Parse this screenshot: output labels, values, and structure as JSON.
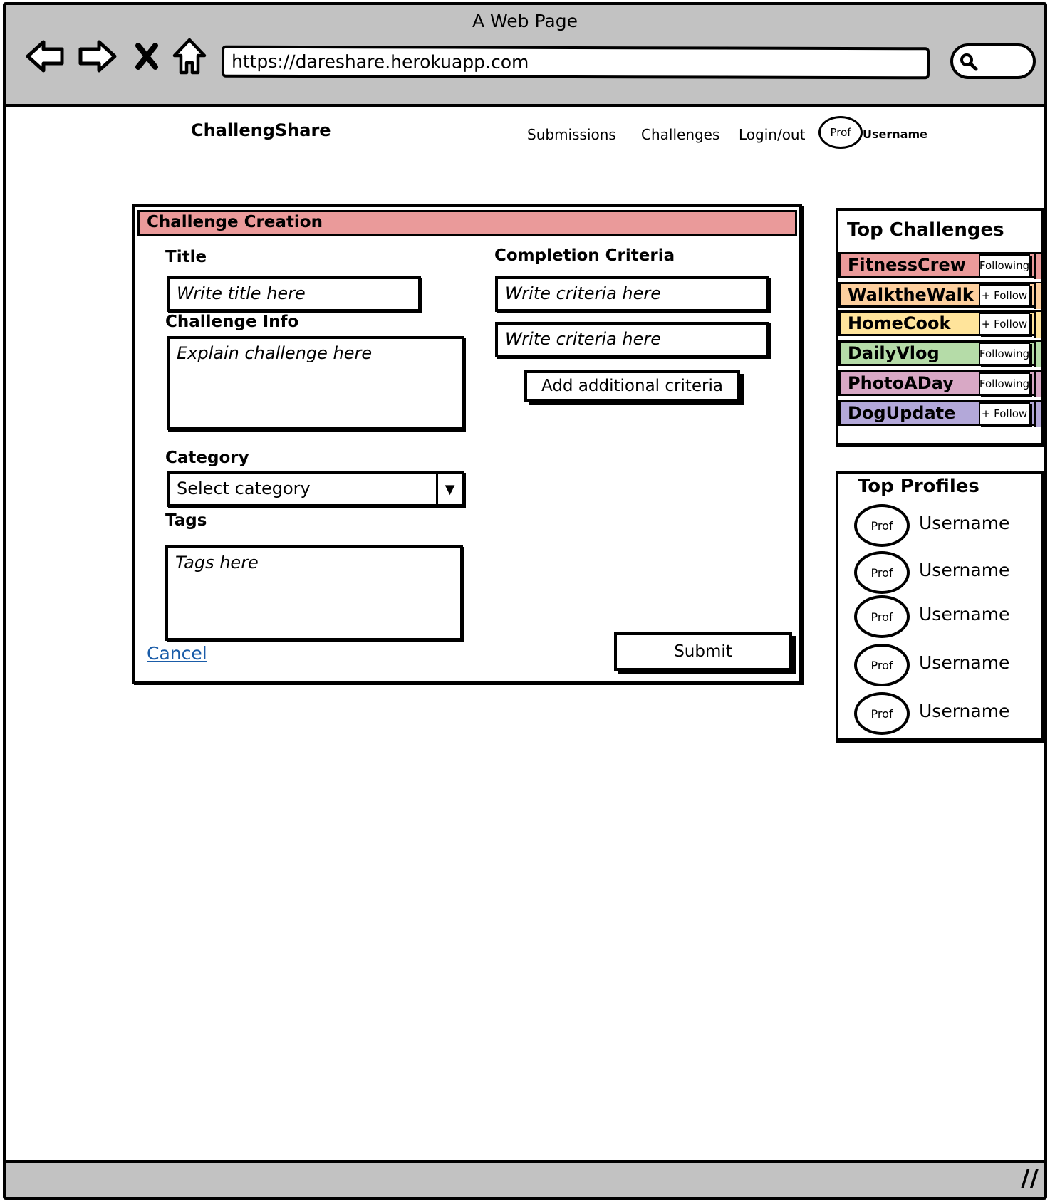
{
  "window": {
    "title": "A Web Page"
  },
  "browser": {
    "url": "https://dareshare.herokuapp.com",
    "icons": [
      "back-arrow-icon",
      "forward-arrow-icon",
      "close-icon",
      "home-icon",
      "search-icon",
      "resize-grip-icon"
    ]
  },
  "header": {
    "brand": "ChallengShare",
    "nav": [
      "Submissions",
      "Challenges",
      "Login/out"
    ],
    "avatar_text": "Prof",
    "username": "Username"
  },
  "form": {
    "title": "Challenge Creation",
    "header_color": "#ea9a9a",
    "title_label": "Title",
    "title_placeholder": "Write title here",
    "info_label": "Challenge Info",
    "info_placeholder": "Explain challenge here",
    "category_label": "Category",
    "category_value": "Select category",
    "tags_label": "Tags",
    "tags_placeholder": "Tags here",
    "criteria_label": "Completion Criteria",
    "criteria": [
      "Write criteria here",
      "Write criteria here"
    ],
    "add_criteria_button": "Add additional criteria",
    "cancel": "Cancel",
    "submit": "Submit"
  },
  "top_challenges": {
    "title": "Top Challenges",
    "items": [
      {
        "name": "FitnessCrew",
        "action": "Following",
        "color": "#ea9a9a"
      },
      {
        "name": "WalktheWalk",
        "action": "+ Follow",
        "color": "#fdcf9e"
      },
      {
        "name": "HomeCook",
        "action": "+ Follow",
        "color": "#ffe49b"
      },
      {
        "name": "DailyVlog",
        "action": "Following",
        "color": "#b5dca8"
      },
      {
        "name": "PhotoADay",
        "action": "Following",
        "color": "#d8a8c5"
      },
      {
        "name": "DogUpdate",
        "action": "+ Follow",
        "color": "#b3a8d9"
      }
    ]
  },
  "top_profiles": {
    "title": "Top Profiles",
    "items": [
      {
        "avatar": "Prof",
        "name": "Username"
      },
      {
        "avatar": "Prof",
        "name": "Username"
      },
      {
        "avatar": "Prof",
        "name": "Username"
      },
      {
        "avatar": "Prof",
        "name": "Username"
      },
      {
        "avatar": "Prof",
        "name": "Username"
      }
    ]
  }
}
